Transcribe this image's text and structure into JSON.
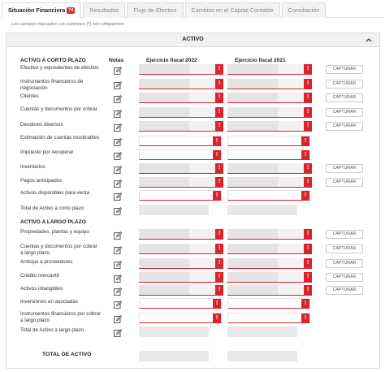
{
  "tabs": [
    {
      "label": "Situación Financiera",
      "badge": "74"
    },
    {
      "label": "Resultados"
    },
    {
      "label": "Flujo de Efectivo"
    },
    {
      "label": "Cambios en el Capital Contable"
    },
    {
      "label": "Conciliación"
    }
  ],
  "note": "Los campos marcados con asterisco (*) son obligatorios",
  "panel": {
    "title": "ACTIVO"
  },
  "columns": {
    "notas": "Notas",
    "y2022": "Ejercicio fiscal 2022",
    "y2021": "Ejercicio fiscal 2021"
  },
  "sections": {
    "corto": "ACTIVO A CORTO PLAZO",
    "largo": "ACTIVO A LARGO PLAZO"
  },
  "button_label": "CAPTURAR",
  "error_glyph": "!",
  "rows": [
    {
      "label": "Efectivo y equivalentes de efectivo"
    },
    {
      "label": "Instrumentos financieros de negociación"
    },
    {
      "label": "Clientes"
    },
    {
      "label": "Cuentas y documentos por cobrar"
    },
    {
      "label": "Deudores diversos"
    },
    {
      "label": "Estimación de cuentas incobrables"
    },
    {
      "label": "Impuesto por recuperar"
    },
    {
      "label": "Inventarios"
    },
    {
      "label": "Pagos anticipados"
    },
    {
      "label": "Activos disponibles para venta"
    },
    {
      "label": "Total de Activo a corto plazo"
    },
    {
      "label": "Propiedades, plantas y equipo"
    },
    {
      "label": "Cuentas y documentos por cobrar a largo plazo"
    },
    {
      "label": "Anticipo a proveedores"
    },
    {
      "label": "Crédito mercantil"
    },
    {
      "label": "Activos intangibles"
    },
    {
      "label": "Inversiones en asociadas"
    },
    {
      "label": "Instrumentos financieros por cobrar a largo plazo"
    },
    {
      "label": "Total de Activo a largo plazo"
    }
  ],
  "total_label": "TOTAL DE ACTIVO",
  "colors": {
    "accent": "#d9232d",
    "field_bg": "#f2f2f2",
    "header_bg": "#f1f1f1"
  }
}
